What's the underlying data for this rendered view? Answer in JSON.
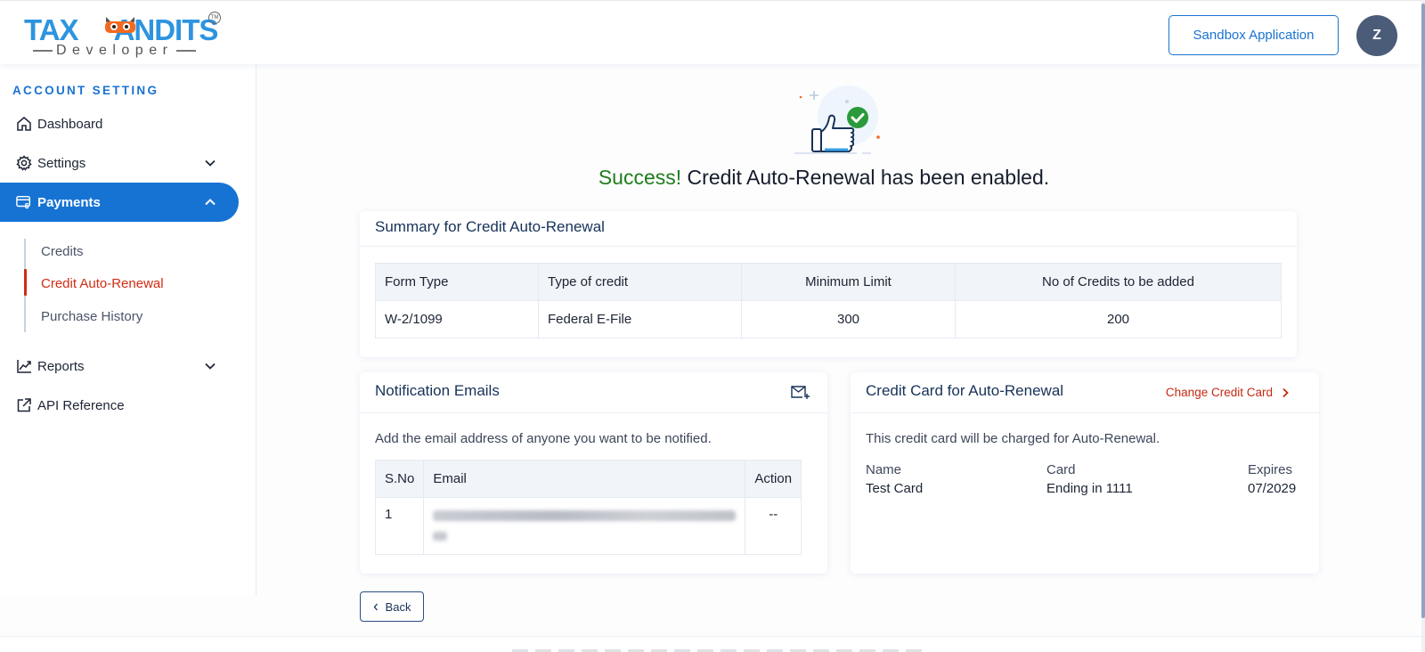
{
  "header": {
    "logo": {
      "brand": "TAXBANDITS",
      "brand_left": "TAX",
      "brand_right": "ANDITS",
      "tm": "TM",
      "sub": "Developer"
    },
    "sandbox_button": "Sandbox Application",
    "avatar_initial": "Z"
  },
  "sidebar": {
    "section_title": "ACCOUNT SETTING",
    "items": [
      {
        "label": "Dashboard",
        "icon": "home-icon"
      },
      {
        "label": "Settings",
        "icon": "gear-icon",
        "expandable": true,
        "expanded": false
      },
      {
        "label": "Payments",
        "icon": "payment-card-icon",
        "expandable": true,
        "expanded": true,
        "active": true
      },
      {
        "label": "Reports",
        "icon": "chart-line-icon",
        "expandable": true,
        "expanded": false
      },
      {
        "label": "API Reference",
        "icon": "external-link-icon"
      }
    ],
    "payments_sub": [
      {
        "label": "Credits"
      },
      {
        "label": "Credit Auto-Renewal",
        "current": true
      },
      {
        "label": "Purchase History"
      }
    ]
  },
  "main": {
    "success": {
      "prefix": "Success!",
      "message": "Credit Auto-Renewal has been enabled."
    },
    "summary": {
      "title": "Summary for Credit Auto-Renewal",
      "columns": [
        "Form Type",
        "Type of credit",
        "Minimum Limit",
        "No of Credits to be added"
      ],
      "rows": [
        [
          "W-2/1099",
          "Federal E-File",
          "300",
          "200"
        ]
      ]
    },
    "notifications": {
      "title": "Notification Emails",
      "description": "Add the email address of anyone you want to be notified.",
      "columns": [
        "S.No",
        "Email",
        "Action"
      ],
      "rows": [
        {
          "sno": "1",
          "email": "[redacted]",
          "action": "--"
        }
      ]
    },
    "credit_card": {
      "title": "Credit Card for Auto-Renewal",
      "change_link": "Change Credit Card",
      "description": "This credit card will be charged for Auto-Renewal.",
      "name_label": "Name",
      "name_value": "Test Card",
      "card_label": "Card",
      "card_value": "Ending in 1111",
      "expires_label": "Expires",
      "expires_value": "07/2029"
    },
    "back_button": "Back"
  },
  "colors": {
    "primary": "#1673d4",
    "accent_red": "#d12b12",
    "success_green": "#1f7d1c",
    "heading_navy": "#173258",
    "avatar_bg": "#4a5c78"
  }
}
